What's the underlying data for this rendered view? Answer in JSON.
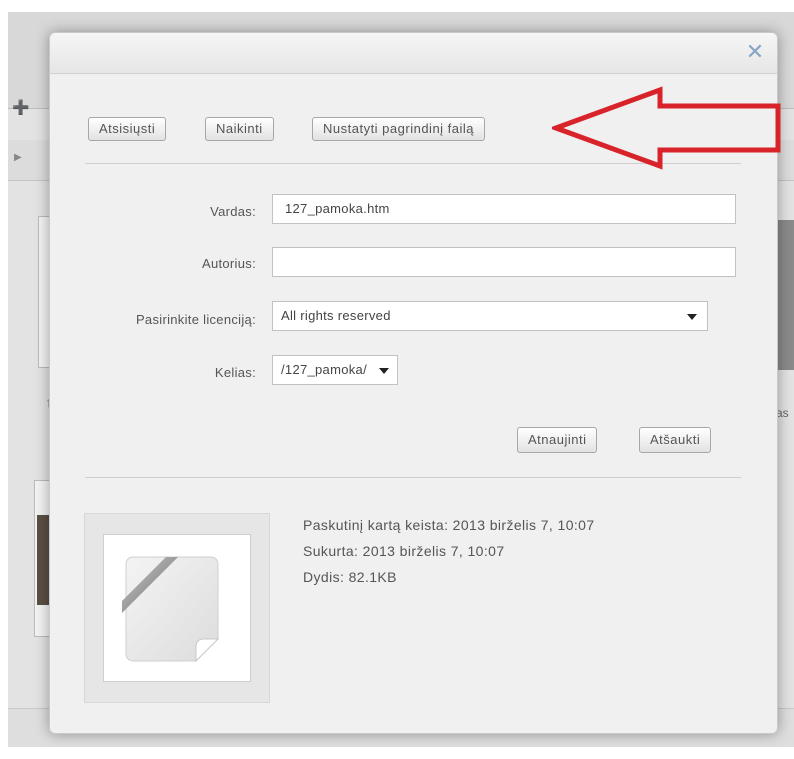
{
  "toolbar": {
    "download_label": "Atsisiųsti",
    "delete_label": "Naikinti",
    "set_main_label": "Nustatyti pagrindinį failą"
  },
  "form": {
    "name_label": "Vardas:",
    "name_value": "127_pamoka.htm",
    "author_label": "Autorius:",
    "author_value": "",
    "license_label": "Pasirinkite licenciją:",
    "license_value": "All rights reserved",
    "path_label": "Kelias:",
    "path_value": "/127_pamoka/"
  },
  "actions": {
    "update_label": "Atnaujinti",
    "cancel_label": "Atšaukti"
  },
  "file_info": {
    "modified": "Paskutinį kartą keista: 2013 birželis 7, 10:07",
    "created": "Sukurta: 2013 birželis 7, 10:07",
    "size": "Dydis: 82.1KB"
  },
  "background": {
    "partial_text": "as"
  },
  "colors": {
    "close_icon": "#86a6c6",
    "annotation_arrow": "#d9232a"
  }
}
